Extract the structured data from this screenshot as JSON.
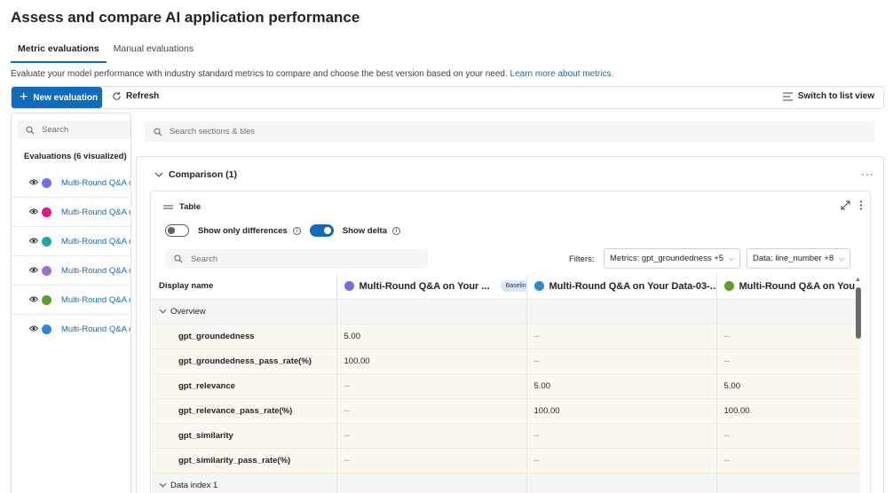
{
  "page": {
    "title": "Assess and compare AI application performance",
    "tabs": [
      {
        "label": "Metric evaluations",
        "active": true
      },
      {
        "label": "Manual evaluations",
        "active": false
      }
    ],
    "description": "Evaluate your model performance with industry standard metrics to compare and choose the best version based on your need.",
    "learn_more": "Learn more about metrics."
  },
  "toolbar": {
    "new_evaluation": "New evaluation",
    "refresh": "Refresh",
    "switch_view": "Switch to list view"
  },
  "sidebar": {
    "search_placeholder": "Search",
    "heading": "Evaluations (6 visualized)",
    "items": [
      {
        "label": "Multi-Round Q&A on Your Data",
        "color": "#6b70e8"
      },
      {
        "label": "Multi-Round Q&A on Your Data",
        "color": "#e3177d"
      },
      {
        "label": "Multi-Round Q&A on Your Data",
        "color": "#1aa8a8"
      },
      {
        "label": "Multi-Round Q&A on Your Data",
        "color": "#9b6fcc"
      },
      {
        "label": "Multi-Round Q&A on Your Data",
        "color": "#5c9e2a"
      },
      {
        "label": "Multi-Round Q&A on Your Data",
        "color": "#2f88d0"
      }
    ]
  },
  "main": {
    "search_placeholder": "Search sections & tiles",
    "comparison_title": "Comparison (1)",
    "table_title": "Table",
    "toggle_differences": "Show only differences",
    "toggle_delta": "Show delta",
    "table_search_placeholder": "Search",
    "filters_label": "Filters:",
    "filter_metrics": "Metrics: gpt_groundedness +5",
    "filter_data": "Data: line_number +8"
  },
  "table": {
    "header_display": "Display name",
    "columns": [
      {
        "label": "Multi-Round Q&A on Your ...",
        "color": "#6b70e8",
        "badge": "Baseline"
      },
      {
        "label": "Multi-Round Q&A on Your Data-03-...",
        "color": "#2f88d0"
      },
      {
        "label": "Multi-Round Q&A on You",
        "color": "#5c9e2a"
      }
    ],
    "overview_label": "Overview",
    "rows": [
      {
        "name": "gpt_groundedness",
        "values": [
          "5.00",
          "--",
          "--"
        ]
      },
      {
        "name": "gpt_groundedness_pass_rate(%)",
        "values": [
          "100.00",
          "--",
          "--"
        ]
      },
      {
        "name": "gpt_relevance",
        "values": [
          "--",
          "5.00",
          "5.00"
        ]
      },
      {
        "name": "gpt_relevance_pass_rate(%)",
        "values": [
          "--",
          "100.00",
          "100.00"
        ]
      },
      {
        "name": "gpt_similarity",
        "values": [
          "--",
          "--",
          "--"
        ]
      },
      {
        "name": "gpt_similarity_pass_rate(%)",
        "values": [
          "--",
          "--",
          "--"
        ]
      }
    ],
    "section2_label": "Data index 1"
  }
}
